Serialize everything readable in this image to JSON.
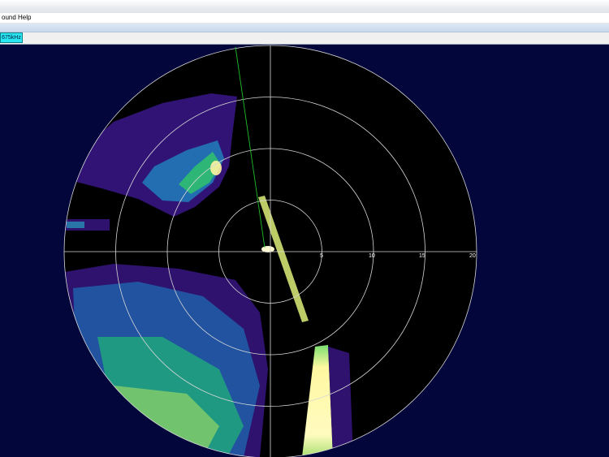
{
  "menu": {
    "sound": "ound",
    "help": "Help"
  },
  "tab": {
    "frequency": "675kHz"
  },
  "sonar": {
    "range_labels": [
      "5",
      "10",
      "15",
      "20"
    ],
    "colors": {
      "background": "#02063a",
      "disc": "#000000",
      "range_rings": "#d7d7d7",
      "heading_line": "#1fbf2a",
      "echo_strong": "#fff7a0",
      "echo_mid": "#22c48a",
      "echo_weak": "#5b1fa8"
    }
  }
}
